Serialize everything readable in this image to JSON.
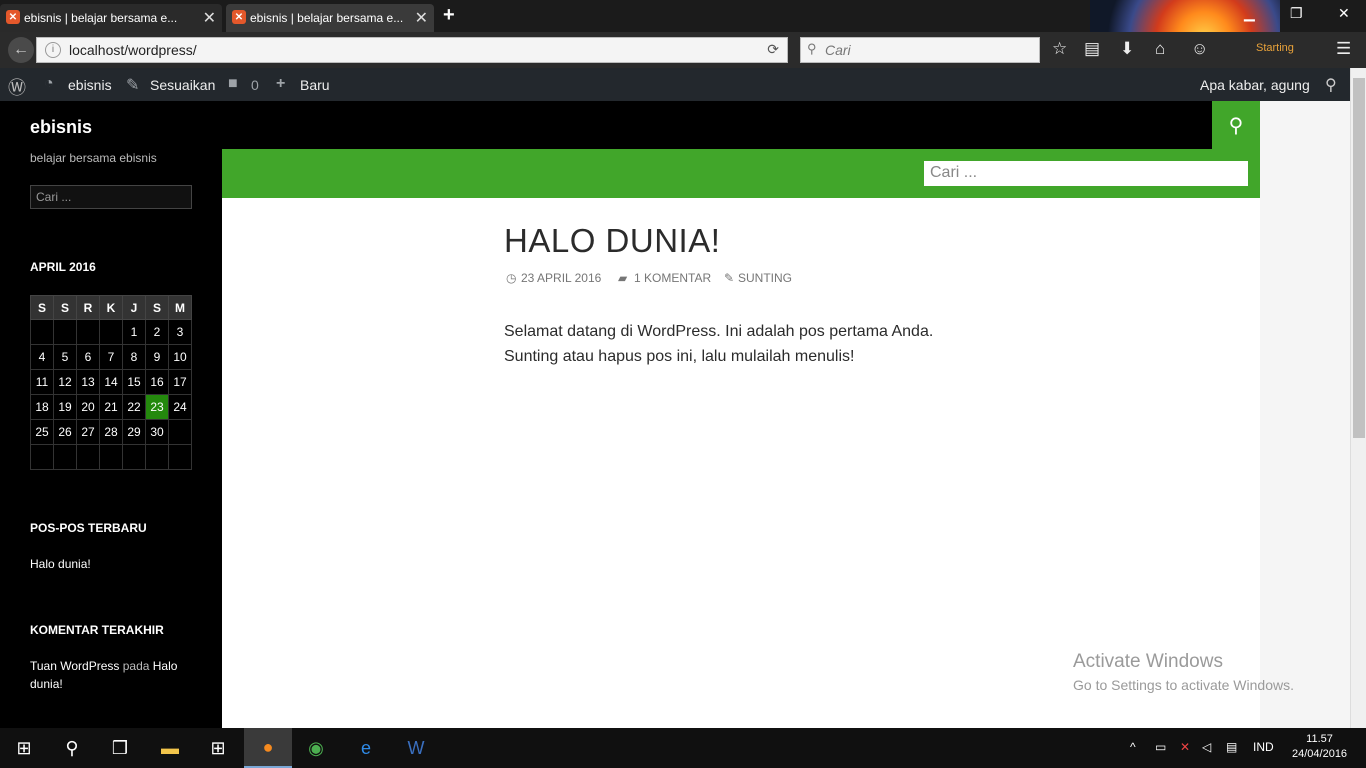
{
  "browser": {
    "tabs": [
      {
        "title": "ebisnis | belajar bersama e..."
      },
      {
        "title": "ebisnis | belajar bersama e..."
      }
    ],
    "new_tab": "+",
    "url": "localhost/wordpress/",
    "search_placeholder": "Cari",
    "status_text": "Starting"
  },
  "admin_bar": {
    "site_name": "ebisnis",
    "customize": "Sesuaikan",
    "comments_count": "0",
    "new_label": "Baru",
    "greeting": "Apa kabar, agung"
  },
  "sidebar": {
    "site_title": "ebisnis",
    "site_description": "belajar bersama ebisnis",
    "search_placeholder": "Cari ...",
    "calendar": {
      "caption": "APRIL 2016",
      "headers": [
        "S",
        "S",
        "R",
        "K",
        "J",
        "S",
        "M"
      ],
      "rows": [
        [
          "",
          "",
          "",
          "",
          "1",
          "2",
          "3"
        ],
        [
          "4",
          "5",
          "6",
          "7",
          "8",
          "9",
          "10"
        ],
        [
          "11",
          "12",
          "13",
          "14",
          "15",
          "16",
          "17"
        ],
        [
          "18",
          "19",
          "20",
          "21",
          "22",
          "23",
          "24"
        ],
        [
          "25",
          "26",
          "27",
          "28",
          "29",
          "30",
          ""
        ],
        [
          "",
          "",
          "",
          "",
          "",
          "",
          ""
        ]
      ],
      "today": "23"
    },
    "recent_posts_title": "POS-POS TERBARU",
    "recent_post": "Halo dunia!",
    "recent_comments_title": "KOMENTAR TERAKHIR",
    "comment_author": "Tuan WordPress",
    "comment_on": "pada",
    "comment_post_a": "Halo",
    "comment_post_b": "dunia!"
  },
  "header": {
    "search_placeholder": "Cari ..."
  },
  "post": {
    "title": "HALO DUNIA!",
    "date": "23 APRIL 2016",
    "comments": "1 KOMENTAR",
    "edit": "SUNTING",
    "body_line1": "Selamat datang di WordPress. Ini adalah pos pertama Anda.",
    "body_line2": "Sunting atau hapus pos ini, lalu mulailah menulis!"
  },
  "watermark": {
    "title": "Activate Windows",
    "subtitle": "Go to Settings to activate Windows."
  },
  "taskbar": {
    "language": "IND",
    "time": "11.57",
    "date": "24/04/2016"
  },
  "colors": {
    "accent_green": "#41a62a",
    "today_green": "#24890d",
    "admin_bar": "#23282d"
  }
}
